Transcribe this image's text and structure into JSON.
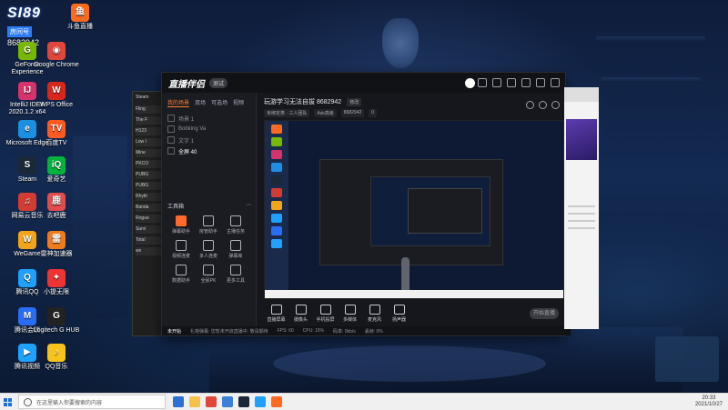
{
  "desktop": {
    "room_badge": {
      "logo": "SI89",
      "label": "房间号",
      "number": "8682942"
    },
    "icons": [
      {
        "label": "斗鱼直播",
        "color": "#ff6a1f",
        "glyph": "鱼"
      },
      {
        "label": "GeForce Experience",
        "color": "#76b900",
        "glyph": "G"
      },
      {
        "label": "Google Chrome",
        "color": "#e0463a",
        "glyph": "◉"
      },
      {
        "label": "IntelliJ IDEA 2020.1.2 x64",
        "color": "#d6336c",
        "glyph": "IJ"
      },
      {
        "label": "WPS Office",
        "color": "#d9261c",
        "glyph": "W"
      },
      {
        "label": "Microsoft Edge",
        "color": "#1c8fe0",
        "glyph": "e"
      },
      {
        "label": "百度TV",
        "color": "#ff5a1f",
        "glyph": "TV"
      },
      {
        "label": "Steam",
        "color": "#1b2838",
        "glyph": "S"
      },
      {
        "label": "爱奇艺",
        "color": "#00b33c",
        "glyph": "iQ"
      },
      {
        "label": "网易云音乐",
        "color": "#d43c33",
        "glyph": "♫"
      },
      {
        "label": "去吧鹿",
        "color": "#e54b4b",
        "glyph": "鹿"
      },
      {
        "label": "WeGame",
        "color": "#f2a51a",
        "glyph": "W"
      },
      {
        "label": "雷神加速器",
        "color": "#ef7b1a",
        "glyph": "雷"
      },
      {
        "label": "腾讯QQ",
        "color": "#1fa0ff",
        "glyph": "Q"
      },
      {
        "label": "小提无限",
        "color": "#e33",
        "glyph": "✦"
      },
      {
        "label": "腾讯会议",
        "color": "#2a6df5",
        "glyph": "M"
      },
      {
        "label": "Logitech G HUB",
        "color": "#222222",
        "glyph": "G"
      },
      {
        "label": "腾讯视频",
        "color": "#20a0ff",
        "glyph": "▶"
      },
      {
        "label": "QQ音乐",
        "color": "#f7c31a",
        "glyph": "♪"
      }
    ]
  },
  "explorer": {
    "title": "Steam",
    "rows": [
      "Fling",
      "The F",
      "H123",
      "Low I",
      "Mine",
      "PKCO",
      "PUBG",
      "PUBG",
      "Rhyth",
      "Banda",
      "Rogue",
      "Survi",
      "Total",
      "ws"
    ]
  },
  "app": {
    "brand": "直播伴侣",
    "version": "测试",
    "tabs": [
      "我的场景",
      "双场",
      "可选场",
      "视频"
    ],
    "scenes": [
      {
        "name": "场景 1",
        "selected": false
      },
      {
        "name": "Bobking Va",
        "selected": false
      },
      {
        "name": "文字 1",
        "selected": false
      },
      {
        "name": "全屏 40",
        "selected": true
      }
    ],
    "tools_header": "工具箱",
    "tools": [
      {
        "label": "弹幕助手",
        "hot": true
      },
      {
        "label": "房管助手",
        "hot": false
      },
      {
        "label": "主播任务",
        "hot": false
      },
      {
        "label": "视频连麦",
        "hot": false
      },
      {
        "label": "多人连麦",
        "hot": false
      },
      {
        "label": "弹幕库",
        "hot": false
      },
      {
        "label": "数据助手",
        "hot": false
      },
      {
        "label": "全民PK",
        "hot": false
      },
      {
        "label": "更多工具",
        "hot": false
      }
    ],
    "room_title": "玩游学习无法自拔 8682942",
    "room_edit": "修改",
    "room_sub": [
      "未绑定类 · 三人团队",
      "Ask高级",
      "8682942",
      "0"
    ],
    "controls": [
      {
        "label": "直播屏幕"
      },
      {
        "label": "摄像头"
      },
      {
        "label": "手机投屏"
      },
      {
        "label": "多媒体"
      },
      {
        "label": "麦克风"
      },
      {
        "label": "扬声器"
      }
    ],
    "start_button": "开始直播",
    "status": {
      "live": "未开始",
      "message": "礼物弹幕: 您暂未开启直播中, 敬请期待",
      "fps": "FPS: 60",
      "cpu": "CPU: 15%",
      "bitrate": "码率: 0kb/s",
      "drop": "丢帧: 0%"
    }
  },
  "taskbar": {
    "search_placeholder": "在这里输入你要搜索的内容",
    "time": "20:33",
    "date": "2021/10/27"
  }
}
